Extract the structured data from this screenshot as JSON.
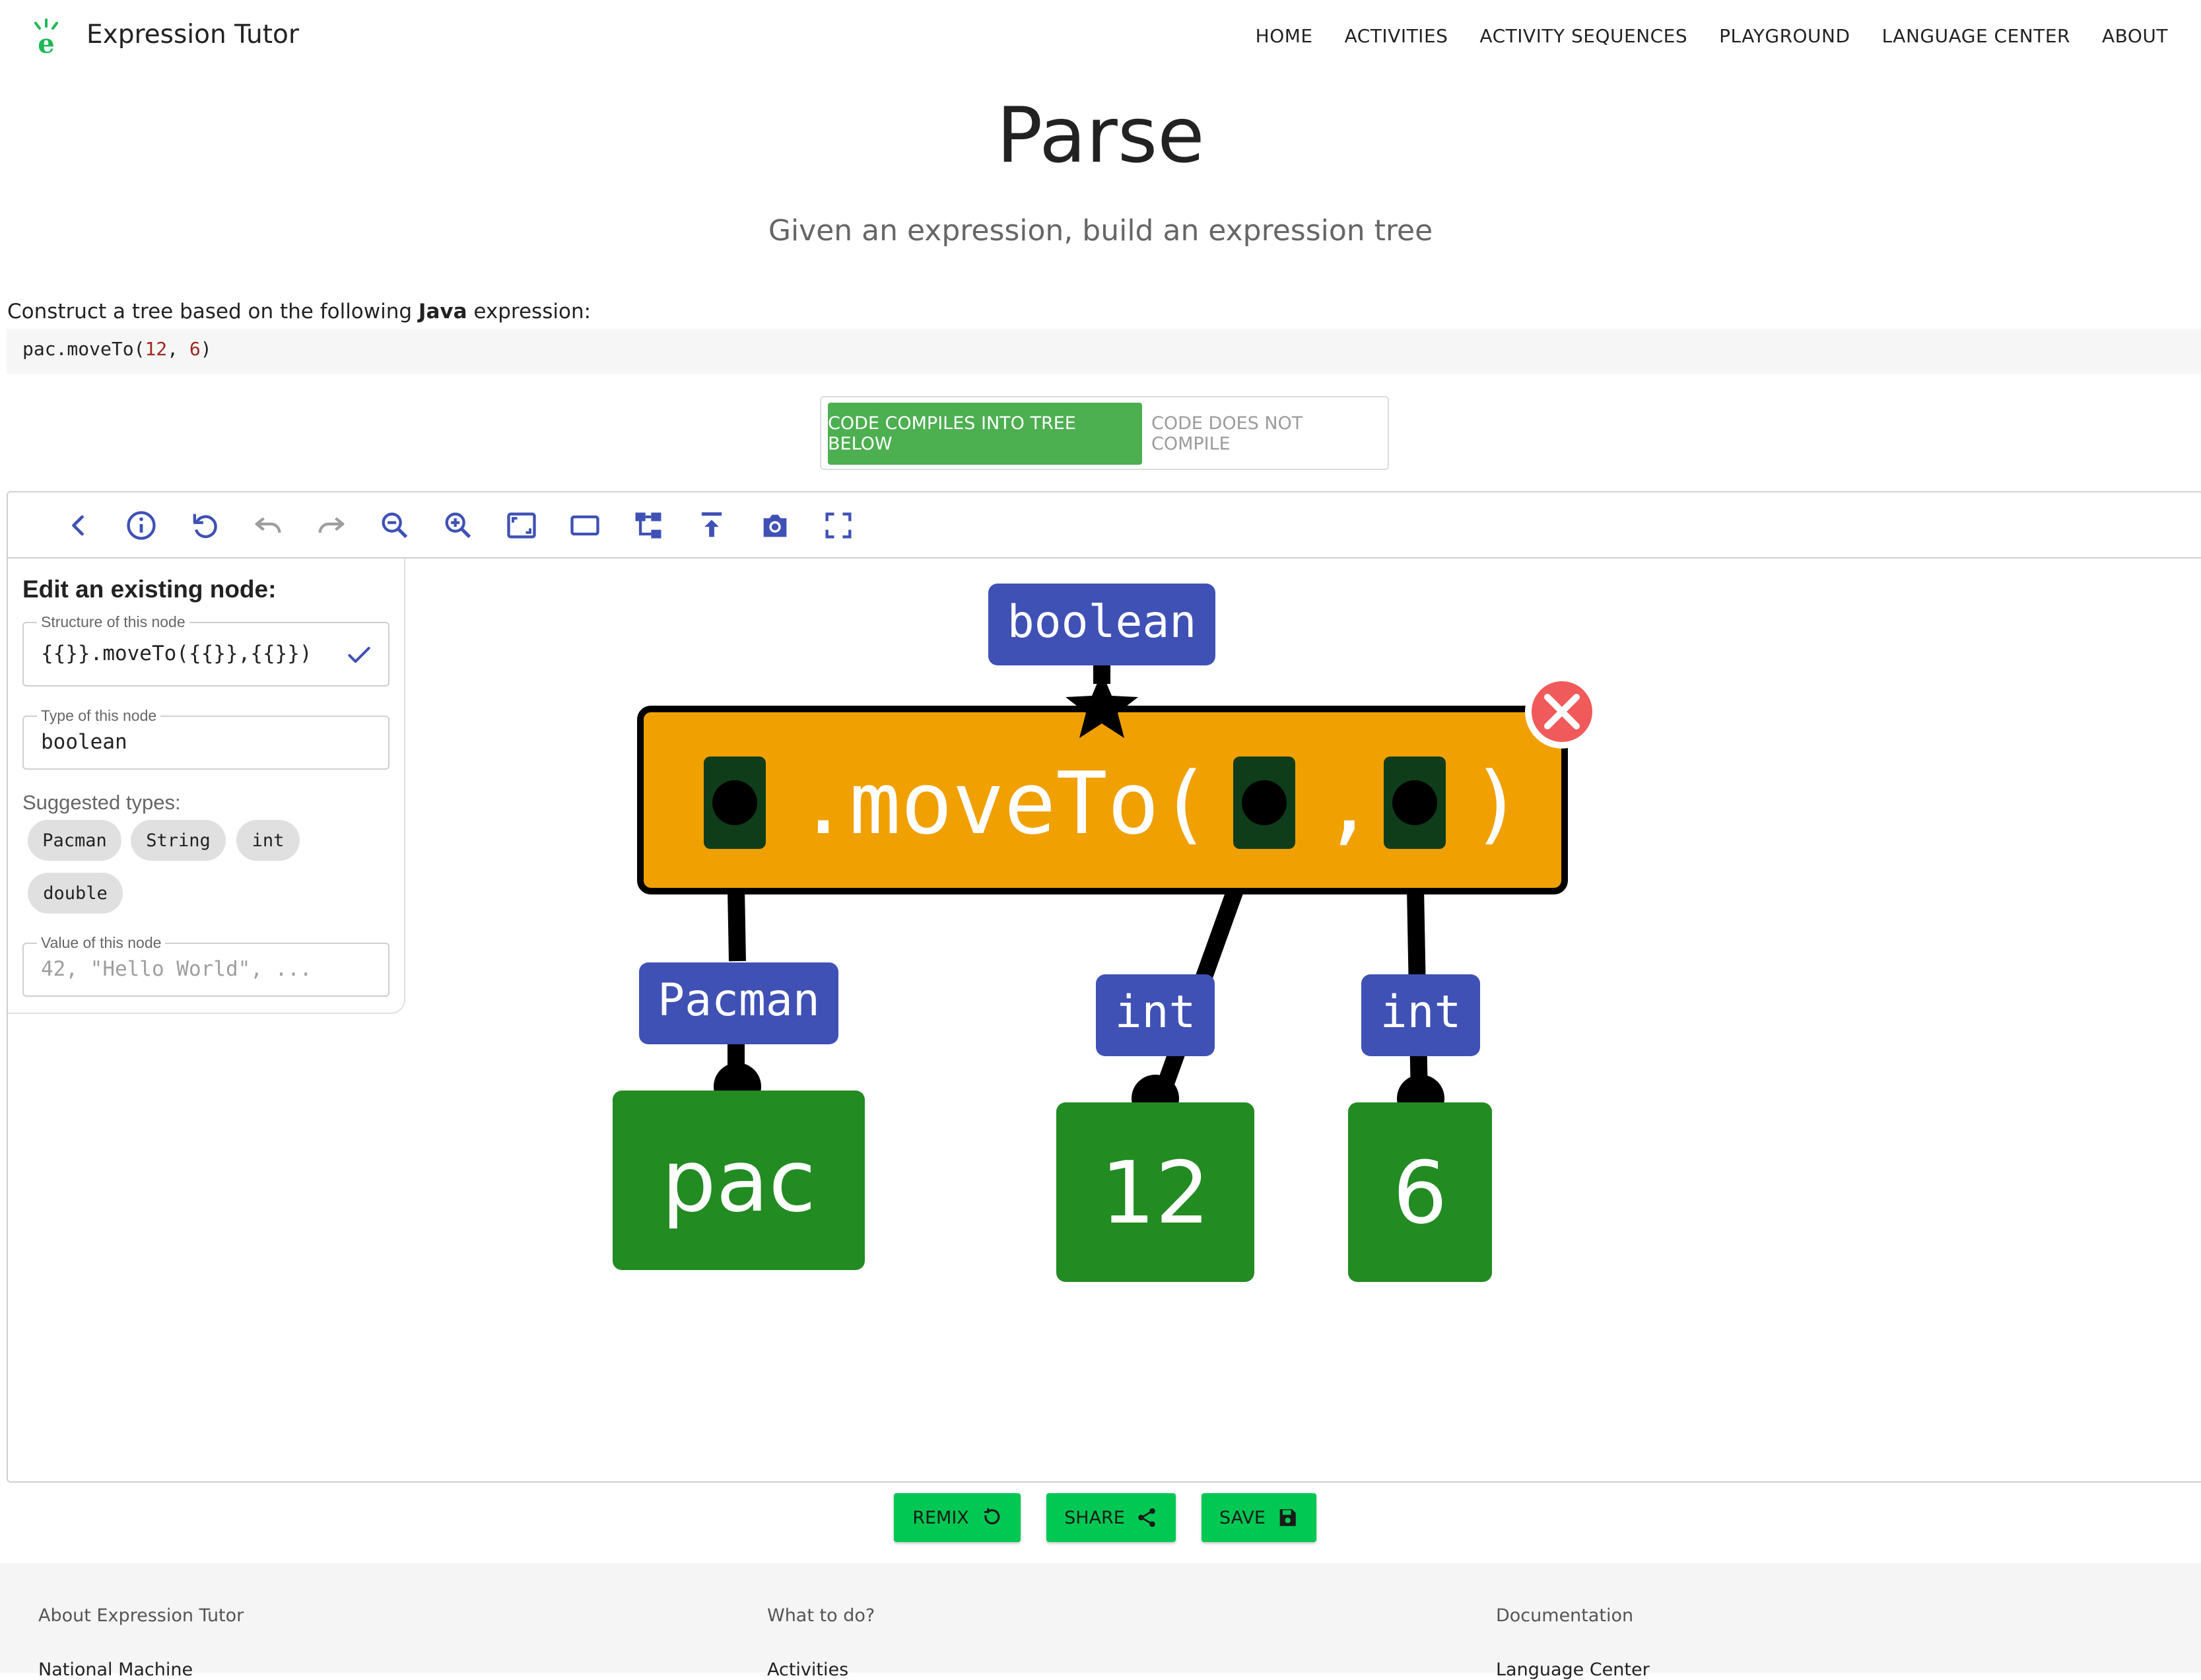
{
  "header": {
    "app_name": "Expression Tutor",
    "logo_letter": "e",
    "nav": [
      "HOME",
      "ACTIVITIES",
      "ACTIVITY SEQUENCES",
      "PLAYGROUND",
      "LANGUAGE CENTER",
      "ABOUT"
    ]
  },
  "page": {
    "title": "Parse",
    "subtitle": "Given an expression, build an expression tree"
  },
  "task": {
    "instruction_prefix": "Construct a tree based on the following ",
    "language": "Java",
    "instruction_suffix": " expression:",
    "code_before": "pac.moveTo(",
    "code_arg1": "12",
    "code_sep": ", ",
    "code_arg2": "6",
    "code_after": ")"
  },
  "compile_toggle": {
    "compiles_label": "CODE COMPILES INTO TREE BELOW",
    "not_compile_label": "CODE DOES NOT COMPILE"
  },
  "toolbar": {
    "icons": [
      "back-icon",
      "info-icon",
      "reset-icon",
      "undo-icon",
      "redo-icon",
      "zoom-out-icon",
      "zoom-in-icon",
      "fit-to-screen-icon",
      "fit-width-icon",
      "tree-layout-icon",
      "export-icon",
      "screenshot-icon",
      "fullscreen-icon"
    ]
  },
  "side_panel": {
    "heading": "Edit an existing node:",
    "structure_label": "Structure of this node",
    "structure_value": "{{}}.moveTo({{}},{{}})",
    "type_label": "Type of this node",
    "type_value": "boolean",
    "suggested_label": "Suggested types:",
    "suggested_types": [
      "Pacman",
      "String",
      "int",
      "double"
    ],
    "value_label": "Value of this node",
    "value_placeholder": "42, \"Hello World\", ..."
  },
  "tree": {
    "root": {
      "type": "boolean",
      "text": ".moveTo(",
      "comma": ",",
      "close": ")"
    },
    "children": [
      {
        "type": "Pacman",
        "value": "pac"
      },
      {
        "type": "int",
        "value": "12"
      },
      {
        "type": "int",
        "value": "6"
      }
    ]
  },
  "actions": {
    "remix": "REMIX",
    "share": "SHARE",
    "save": "SAVE"
  },
  "footer": {
    "col1_title": "About Expression Tutor",
    "col2_title": "What to do?",
    "col3_title": "Documentation",
    "col1_link": "National Machine",
    "col2_link": "Activities",
    "col3_link": "Language Center"
  },
  "colors": {
    "accent_green": "#4caf50",
    "action_green": "#00c853",
    "type_badge": "#3f51b5",
    "root_node": "#f0a000",
    "leaf_node": "#228b22",
    "hole": "#0f3d1a",
    "delete_red": "#f05a5a"
  }
}
